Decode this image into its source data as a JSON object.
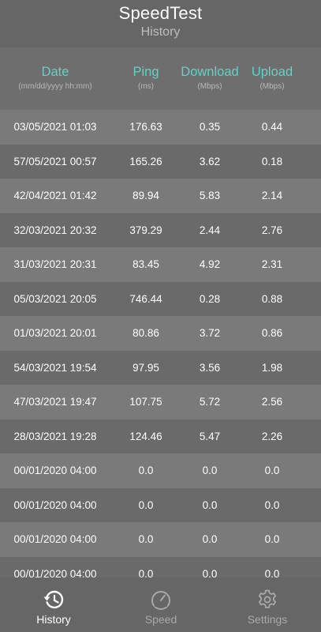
{
  "header": {
    "title": "SpeedTest",
    "subtitle": "History"
  },
  "columns": {
    "date": {
      "label": "Date",
      "unit": "(mm/dd/yyyy hh:mm)"
    },
    "ping": {
      "label": "Ping",
      "unit": "(ms)"
    },
    "download": {
      "label": "Download",
      "unit": "(Mbps)"
    },
    "upload": {
      "label": "Upload",
      "unit": "(Mbps)"
    }
  },
  "rows": [
    {
      "date": "03/05/2021 01:03",
      "ping": "176.63",
      "download": "0.35",
      "upload": "0.44"
    },
    {
      "date": "57/05/2021 00:57",
      "ping": "165.26",
      "download": "3.62",
      "upload": "0.18"
    },
    {
      "date": "42/04/2021 01:42",
      "ping": "89.94",
      "download": "5.83",
      "upload": "2.14"
    },
    {
      "date": "32/03/2021 20:32",
      "ping": "379.29",
      "download": "2.44",
      "upload": "2.76"
    },
    {
      "date": "31/03/2021 20:31",
      "ping": "83.45",
      "download": "4.92",
      "upload": "2.31"
    },
    {
      "date": "05/03/2021 20:05",
      "ping": "746.44",
      "download": "0.28",
      "upload": "0.88"
    },
    {
      "date": "01/03/2021 20:01",
      "ping": "80.86",
      "download": "3.72",
      "upload": "0.86"
    },
    {
      "date": "54/03/2021 19:54",
      "ping": "97.95",
      "download": "3.56",
      "upload": "1.98"
    },
    {
      "date": "47/03/2021 19:47",
      "ping": "107.75",
      "download": "5.72",
      "upload": "2.56"
    },
    {
      "date": "28/03/2021 19:28",
      "ping": "124.46",
      "download": "5.47",
      "upload": "2.26"
    },
    {
      "date": "00/01/2020 04:00",
      "ping": "0.0",
      "download": "0.0",
      "upload": "0.0"
    },
    {
      "date": "00/01/2020 04:00",
      "ping": "0.0",
      "download": "0.0",
      "upload": "0.0"
    },
    {
      "date": "00/01/2020 04:00",
      "ping": "0.0",
      "download": "0.0",
      "upload": "0.0"
    },
    {
      "date": "00/01/2020 04:00",
      "ping": "0.0",
      "download": "0.0",
      "upload": "0.0"
    }
  ],
  "nav": {
    "items": [
      {
        "label": "History",
        "icon": "history-icon",
        "active": true
      },
      {
        "label": "Speed",
        "icon": "speedometer-icon",
        "active": false
      },
      {
        "label": "Settings",
        "icon": "gear-icon",
        "active": false
      }
    ]
  },
  "colors": {
    "accent": "#5fd3c6",
    "row_light": "#7a7a7a",
    "row_dark": "#6a6a6a",
    "background": "#6e6e6e"
  }
}
